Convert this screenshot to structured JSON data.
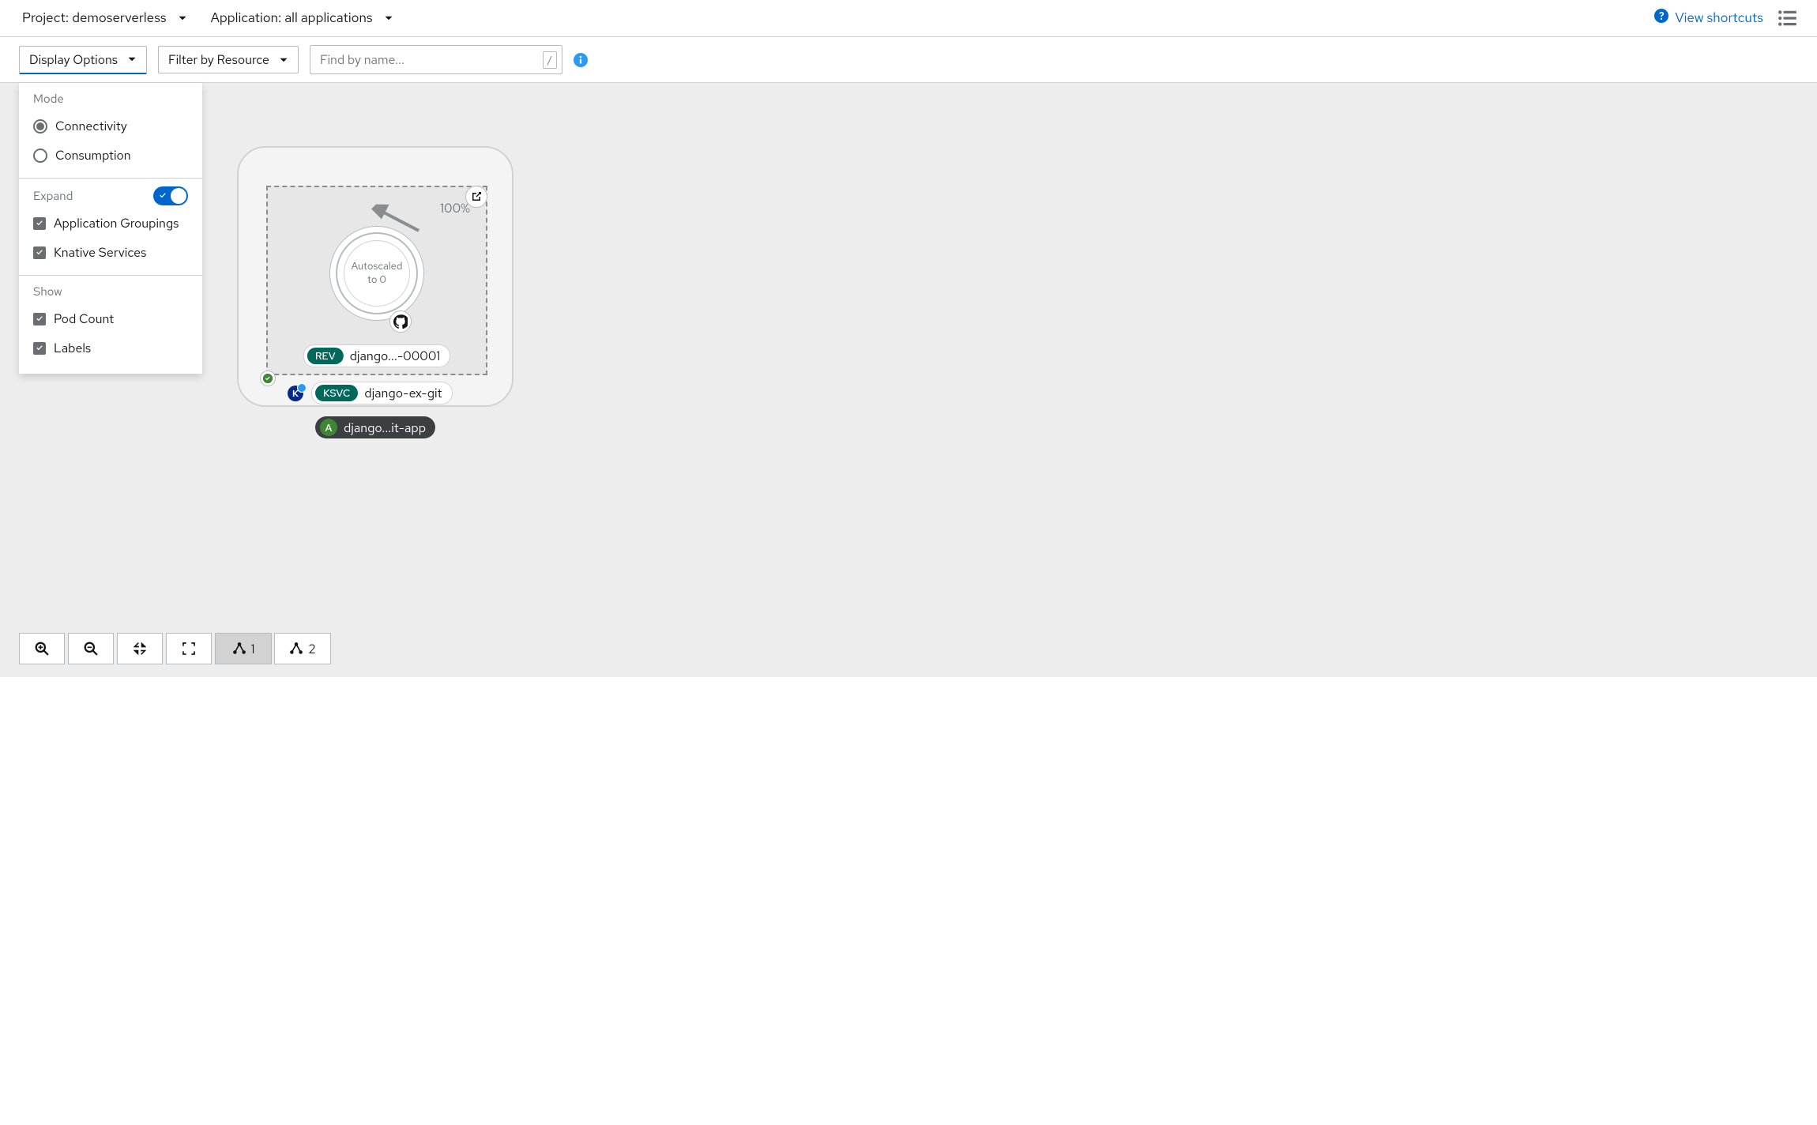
{
  "context_bar": {
    "project": {
      "label_prefix": "Project:",
      "value": "demoserverless"
    },
    "application": {
      "label_prefix": "Application:",
      "value": "all applications"
    },
    "view_shortcuts": "View shortcuts"
  },
  "toolbar": {
    "display_options_label": "Display Options",
    "filter_resource_label": "Filter by Resource",
    "name_filter_placeholder": "Find by name...",
    "name_filter_hint": "/"
  },
  "display_options": {
    "mode": {
      "title": "Mode",
      "options": {
        "connectivity": {
          "label": "Connectivity",
          "checked": true
        },
        "consumption": {
          "label": "Consumption",
          "checked": false
        }
      }
    },
    "expand": {
      "title": "Expand",
      "on": true,
      "app_groupings": {
        "label": "Application Groupings",
        "checked": true
      },
      "knative_services": {
        "label": "Knative Services",
        "checked": true
      }
    },
    "show": {
      "title": "Show",
      "pod_count": {
        "label": "Pod Count",
        "checked": true
      },
      "labels": {
        "label": "Labels",
        "checked": true
      }
    }
  },
  "topology": {
    "traffic": "100%",
    "pod_state_line1": "Autoscaled",
    "pod_state_line2": "to 0",
    "revision": {
      "badge": "REV",
      "name": "django...-00001"
    },
    "ksvc": {
      "k_text": "K",
      "badge": "KSVC",
      "name": "django-ex-git"
    },
    "app": {
      "badge": "A",
      "name": "django...it-app"
    }
  },
  "zoom_bar": {
    "layout_1": "1",
    "layout_2": "2"
  }
}
